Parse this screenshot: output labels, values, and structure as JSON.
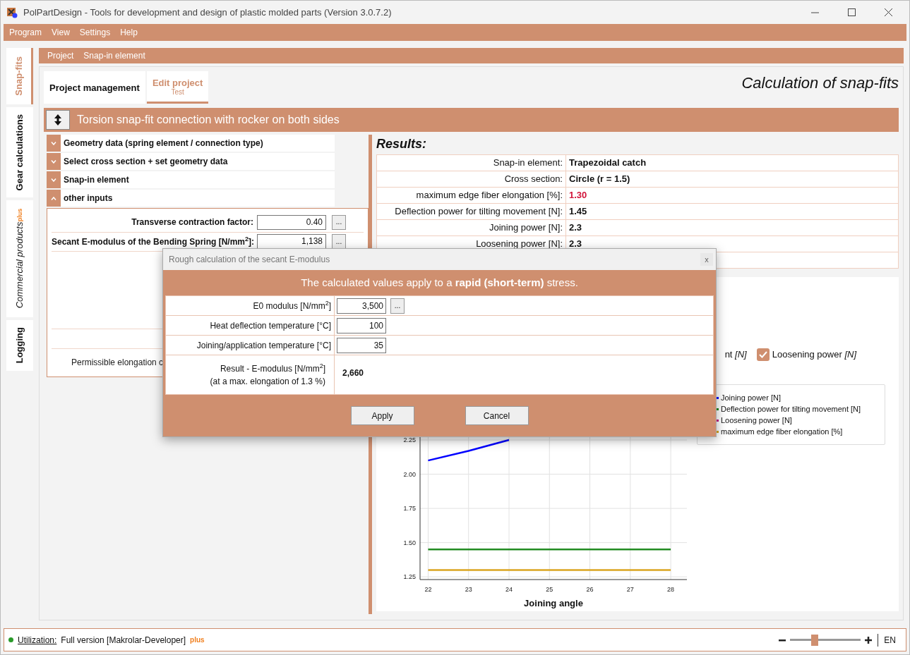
{
  "window": {
    "title": "PolPartDesign - Tools for development and design of plastic molded parts (Version 3.0.7.2)"
  },
  "menu": [
    "Program",
    "View",
    "Settings",
    "Help"
  ],
  "side_tabs": [
    {
      "label": "Snap-fits",
      "selected": true
    },
    {
      "label": "Gear calculations",
      "selected": false
    },
    {
      "label": "Commercial products",
      "badge": "plus",
      "selected": false
    },
    {
      "label": "Logging",
      "selected": false
    }
  ],
  "breadcrumb": [
    "Project",
    "Snap-in element"
  ],
  "tabs": [
    {
      "label": "Project management",
      "selected": false
    },
    {
      "label": "Edit project",
      "sublabel": "Test",
      "selected": true
    }
  ],
  "page_title": "Calculation of snap-fits",
  "section_title": "Torsion snap-fit connection with rocker on both sides",
  "accordion": [
    {
      "label": "Geometry data (spring element / connection type)",
      "expanded": false
    },
    {
      "label": "Select cross section + set geometry data",
      "expanded": false
    },
    {
      "label": "Snap-in element",
      "expanded": false
    },
    {
      "label": "other inputs",
      "expanded": true
    }
  ],
  "other_inputs": [
    {
      "label": "Transverse contraction factor:",
      "value": "0.40",
      "button": "..."
    },
    {
      "label": "Secant E-modulus of the Bending Spring [N/mm$^{2}$]:",
      "value": "1,138",
      "button": "..."
    }
  ],
  "permissible_label": "Permissible elongation c",
  "results": {
    "title": "Results:",
    "rows": [
      {
        "label": "Snap-in element:",
        "value": "Trapezoidal catch",
        "warning": false
      },
      {
        "label": "Cross section:",
        "value": "Circle (r = 1.5)",
        "warning": false
      },
      {
        "label": "maximum edge fiber elongation [%]:",
        "value": "1.30",
        "warning": true
      },
      {
        "label": "Deflection power for tilting movement [N]:",
        "value": "1.45",
        "warning": false
      },
      {
        "label": "Joining power [N]:",
        "value": "2.3",
        "warning": false
      },
      {
        "label": "Loosening power [N]:",
        "value": "2.3",
        "warning": false
      }
    ]
  },
  "series_toggles": [
    {
      "label": "nt *[N]*"
    },
    {
      "label": "Loosening power *[N]*",
      "checked": true
    }
  ],
  "chart": {
    "chart_data": {
      "type": "line",
      "grid": true,
      "xlabel": "Joining angle",
      "x": [
        22,
        23,
        24,
        25,
        26,
        27,
        28
      ],
      "xlim": [
        21.8,
        28.4
      ],
      "ylim": [
        1.23,
        2.75
      ],
      "xticks": [
        22,
        23,
        24,
        25,
        26,
        27,
        28
      ],
      "yticks": [
        {
          "value": 1.25,
          "label": "1.25"
        },
        {
          "value": 1.5,
          "label": "1.50"
        },
        {
          "value": 1.75,
          "label": "1.75"
        },
        {
          "value": 2.0,
          "label": "2.00"
        },
        {
          "value": 2.25,
          "label": "2.25"
        }
      ],
      "series": [
        {
          "name": "Joining power [N]",
          "color": "#0000ff",
          "values": [
            2.1,
            2.17,
            2.25,
            null,
            null,
            null,
            null
          ]
        },
        {
          "name": "Deflection power for tilting movement [N]",
          "color": "#228b22",
          "values": [
            1.45,
            1.45,
            1.45,
            1.45,
            1.45,
            1.45,
            1.45
          ]
        },
        {
          "name": "Loosening power [N]",
          "color": "#c71585",
          "values": [
            null,
            null,
            null,
            null,
            null,
            null,
            null
          ]
        },
        {
          "name": "maximum edge fiber elongation [%]",
          "color": "#daa520",
          "values": [
            1.3,
            1.3,
            1.3,
            1.3,
            1.3,
            1.3,
            1.3
          ]
        }
      ]
    }
  },
  "dialog": {
    "title": "Rough calculation of the secant E-modulus",
    "close": "x",
    "notice": "The calculated values apply to a **rapid (short-term)** stress.",
    "fields": [
      {
        "label": "E0 modulus [N/mm$^{2}$]",
        "value": "3,500",
        "button": "..."
      },
      {
        "label": "Heat deflection temperature [°C]",
        "value": "100"
      },
      {
        "label": "Joining/application temperature [°C]",
        "value": "35"
      }
    ],
    "result": {
      "label": "Result - E-modulus [N/mm$^{2}$]",
      "note": "(at a max. elongation of 1.3 %)",
      "value": "2,660"
    },
    "buttons": [
      "Apply",
      "Cancel"
    ]
  },
  "status_bar": {
    "link": "Utilization:",
    "text": "Full version [Makrolar-Developer]",
    "badge": "plus",
    "zoom": {
      "level": 0.35
    },
    "language": "EN"
  }
}
